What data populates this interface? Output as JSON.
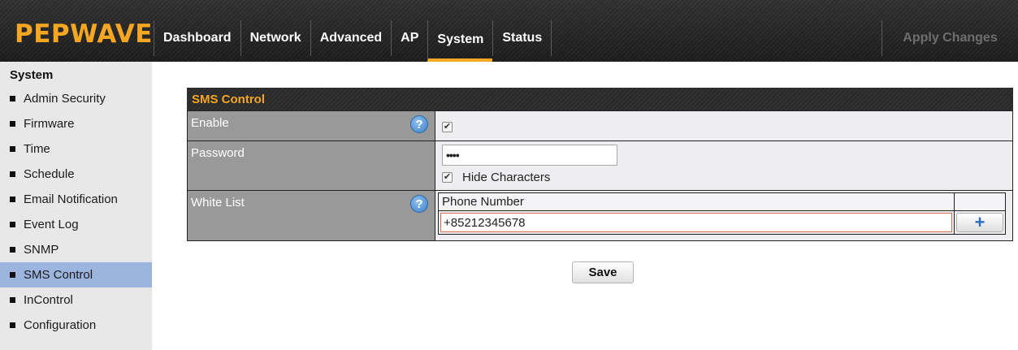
{
  "brand": {
    "name": "PEPWAVE",
    "color": "#f5a623"
  },
  "nav": {
    "items": [
      "Dashboard",
      "Network",
      "Advanced",
      "AP",
      "System",
      "Status"
    ],
    "active": "System",
    "apply_label": "Apply Changes"
  },
  "sidebar": {
    "title": "System",
    "items": [
      "Admin Security",
      "Firmware",
      "Time",
      "Schedule",
      "Email Notification",
      "Event Log",
      "SNMP",
      "SMS Control",
      "InControl",
      "Configuration"
    ],
    "active": "SMS Control",
    "active_color": "#9bb5de"
  },
  "panel": {
    "title": "SMS Control",
    "enable": {
      "label": "Enable",
      "checked": true
    },
    "password": {
      "label": "Password",
      "masked_value": "••••",
      "hide_characters_label": "Hide Characters",
      "hide_checked": true
    },
    "white_list": {
      "label": "White List",
      "column_header": "Phone Number",
      "entry_value": "+85212345678",
      "add_symbol": "+"
    },
    "help_symbol": "?",
    "check_symbol": "✔"
  },
  "actions": {
    "save_label": "Save"
  }
}
